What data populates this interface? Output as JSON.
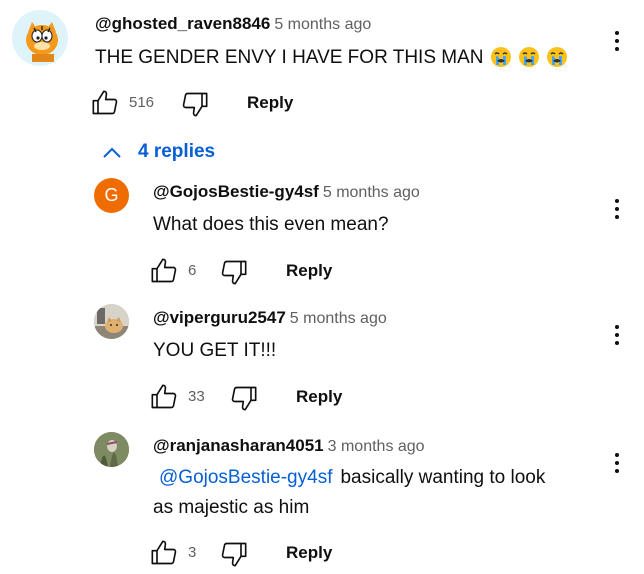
{
  "comments": [
    {
      "author": "@ghosted_raven8846",
      "time": "5 months ago",
      "text": "THE GENDER ENVY I HAVE FOR THIS MAN",
      "likes": "516",
      "reply_label": "Reply"
    },
    {
      "author": "@GojosBestie-gy4sf",
      "time": "5 months ago",
      "text": "What does this even mean?",
      "likes": "6",
      "reply_label": "Reply",
      "avatar_letter": "G"
    },
    {
      "author": "@viperguru2547",
      "time": "5 months ago",
      "text": "YOU GET IT!!!",
      "likes": "33",
      "reply_label": "Reply"
    },
    {
      "author": "@ranjanasharan4051",
      "time": "3 months ago",
      "mention": "@GojosBestie-gy4sf",
      "text_line1": "basically wanting to look",
      "text_line2": "as majestic as him",
      "likes": "3",
      "reply_label": "Reply"
    }
  ],
  "replies_toggle": "4 replies",
  "colors": {
    "accent": "#065fd4",
    "avatar_g": "#ef6c00"
  }
}
